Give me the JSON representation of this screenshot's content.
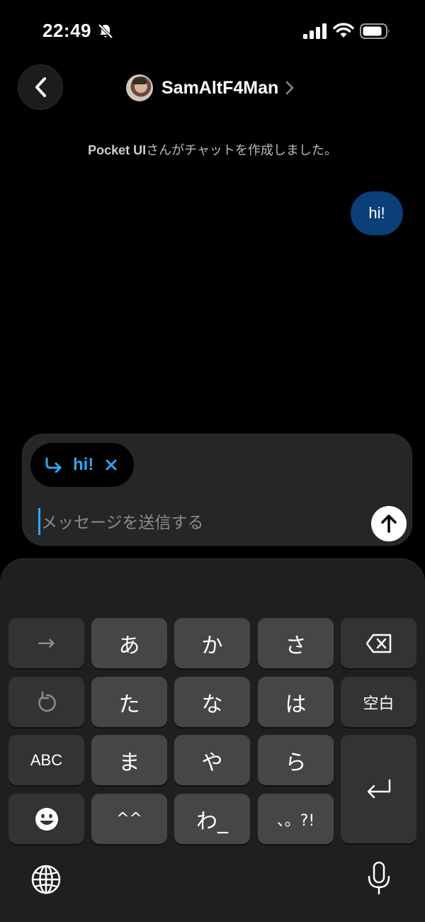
{
  "status_bar": {
    "time": "22:49",
    "icons": [
      "bell-off-icon",
      "signal-icon",
      "wifi-icon",
      "battery-icon"
    ]
  },
  "header": {
    "back_icon": "chevron-left-icon",
    "user_name": "SamAltF4Man",
    "chevron_icon": "chevron-right-icon"
  },
  "messages": {
    "system_actor": "Pocket UI",
    "system_text": "さんがチャットを作成しました。",
    "outgoing": "hi!"
  },
  "composer": {
    "reply_text": "hi!",
    "placeholder": "メッセージを送信する",
    "value": ""
  },
  "keyboard": {
    "row1": [
      "→",
      "あ",
      "か",
      "さ"
    ],
    "row2": [
      "た",
      "な",
      "は",
      "空白"
    ],
    "row3": [
      "ABC",
      "ま",
      "や",
      "ら"
    ],
    "row4": [
      "^^",
      "わ_",
      "、。?!"
    ],
    "icons": [
      "backspace-icon",
      "undo-icon",
      "return-icon",
      "emoji-icon",
      "globe-icon",
      "microphone-icon"
    ]
  },
  "colors": {
    "background": "#000000",
    "bubble": "#0b3f78",
    "accent": "#2fa7f0",
    "composer": "#262628",
    "key": "#464648",
    "key_dark": "#333335",
    "keyboard_bg": "#1f1f21"
  }
}
